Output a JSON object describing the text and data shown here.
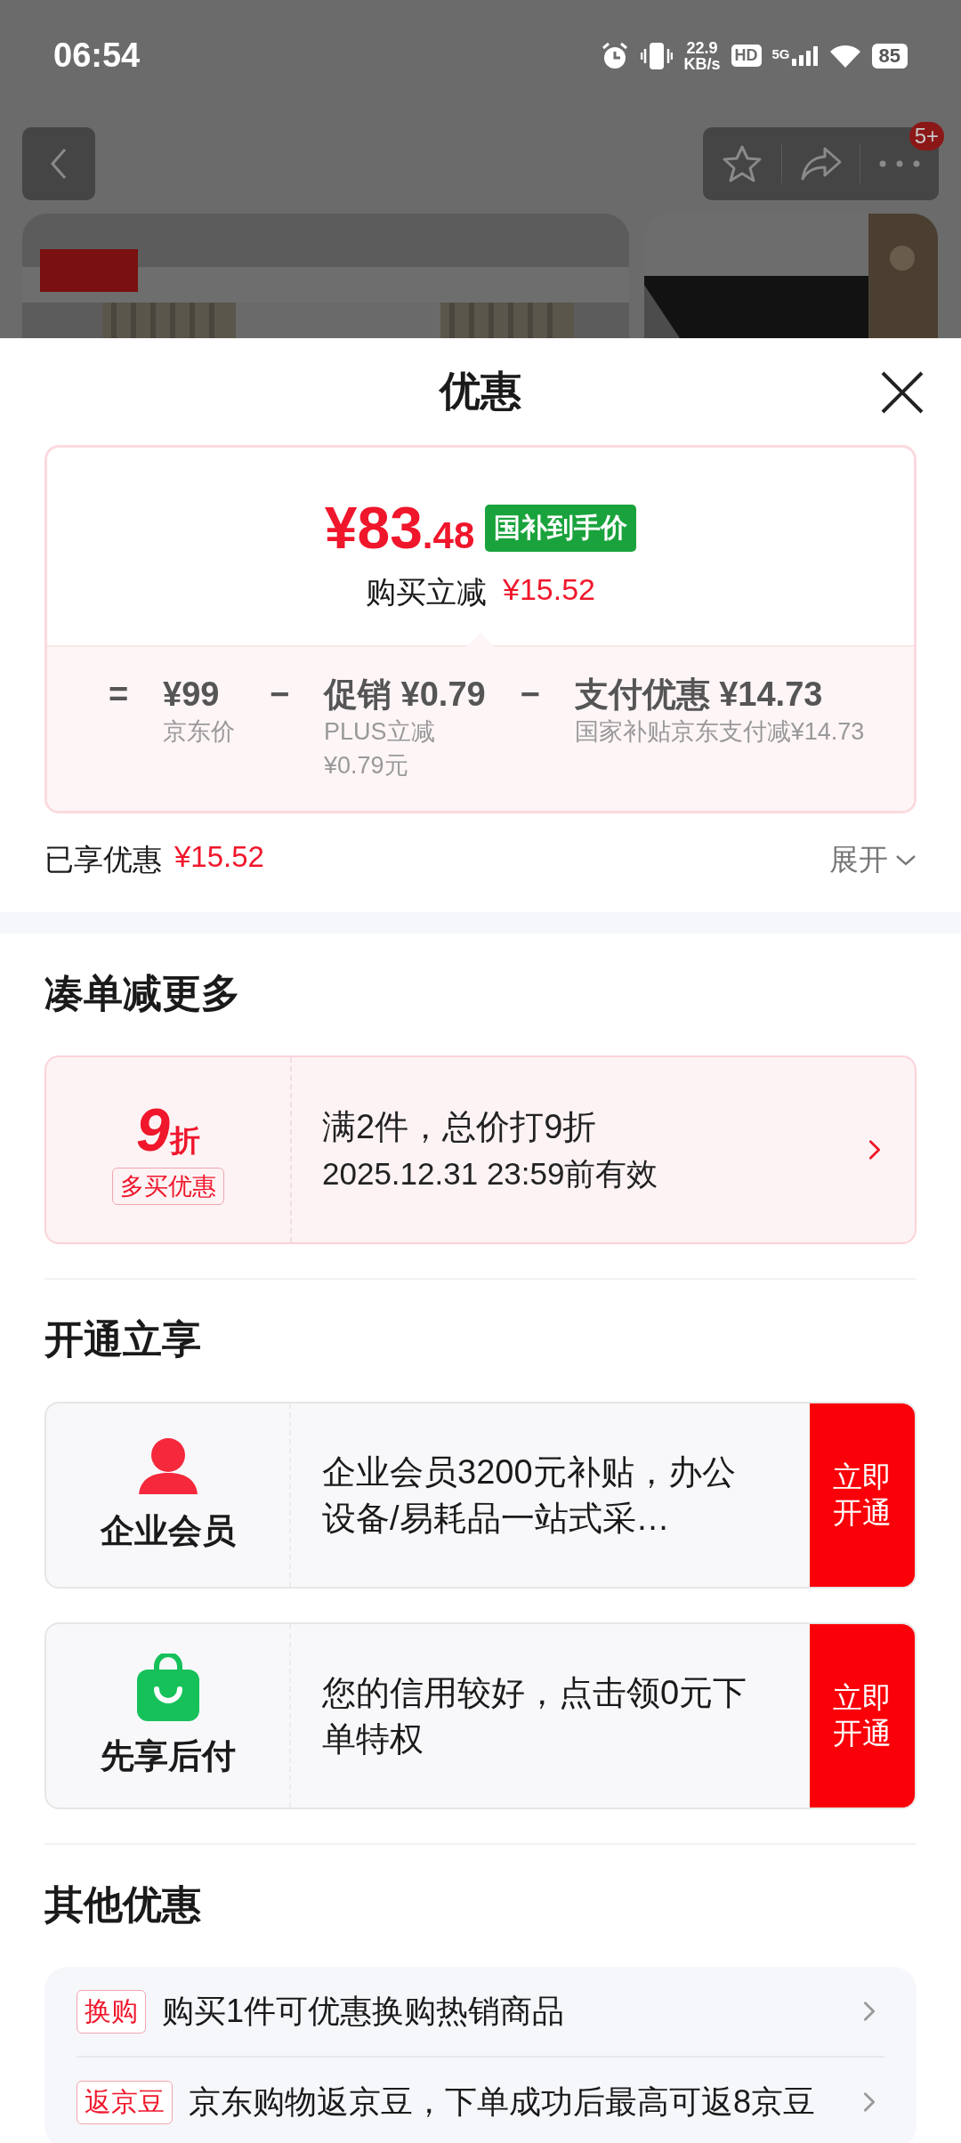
{
  "status_bar": {
    "time": "06:54",
    "net_speed": "22.9",
    "net_unit": "KB/s",
    "hd": "HD",
    "network": "5G",
    "battery": "85"
  },
  "nav": {
    "badge": "5+"
  },
  "sheet": {
    "title": "优惠"
  },
  "price_card": {
    "price_int": "¥83",
    "price_dec": ".48",
    "tag": "国补到手价",
    "saving_label": "购买立减",
    "saving": "¥15.52",
    "breakdown": [
      {
        "op": "=",
        "amount": "¥99",
        "lines": [
          "京东价"
        ]
      },
      {
        "op": "−",
        "amount": "促销 ¥0.79",
        "lines": [
          "PLUS立减",
          "¥0.79元"
        ]
      },
      {
        "op": "−",
        "amount": "支付优惠 ¥14.73",
        "lines": [
          "国家补贴京东支付减¥14.73"
        ]
      }
    ]
  },
  "total": {
    "label": "已享优惠",
    "amount": "¥15.52",
    "expand": "展开"
  },
  "bundle": {
    "heading": "凑单减更多",
    "coupon": {
      "value": "9",
      "unit": "折",
      "tag": "多买优惠",
      "title": "满2件，总价打9折",
      "validity": "2025.12.31 23:59前有效"
    }
  },
  "membership": {
    "heading": "开通立享",
    "offers": [
      {
        "kind": "member",
        "name": "企业会员",
        "desc": "企业会员3200元补贴，办公设备/易耗品一站式采…",
        "button": "立即开通"
      },
      {
        "kind": "paylater",
        "name": "先享后付",
        "desc": "您的信用较好，点击领0元下单特权",
        "button": "立即开通"
      }
    ]
  },
  "other": {
    "heading": "其他优惠",
    "items": [
      {
        "tag": "换购",
        "text": "购买1件可优惠换购热销商品"
      },
      {
        "tag": "返京豆",
        "text": "京东购物返京豆，下单成功后最高可返8京豆"
      }
    ]
  }
}
